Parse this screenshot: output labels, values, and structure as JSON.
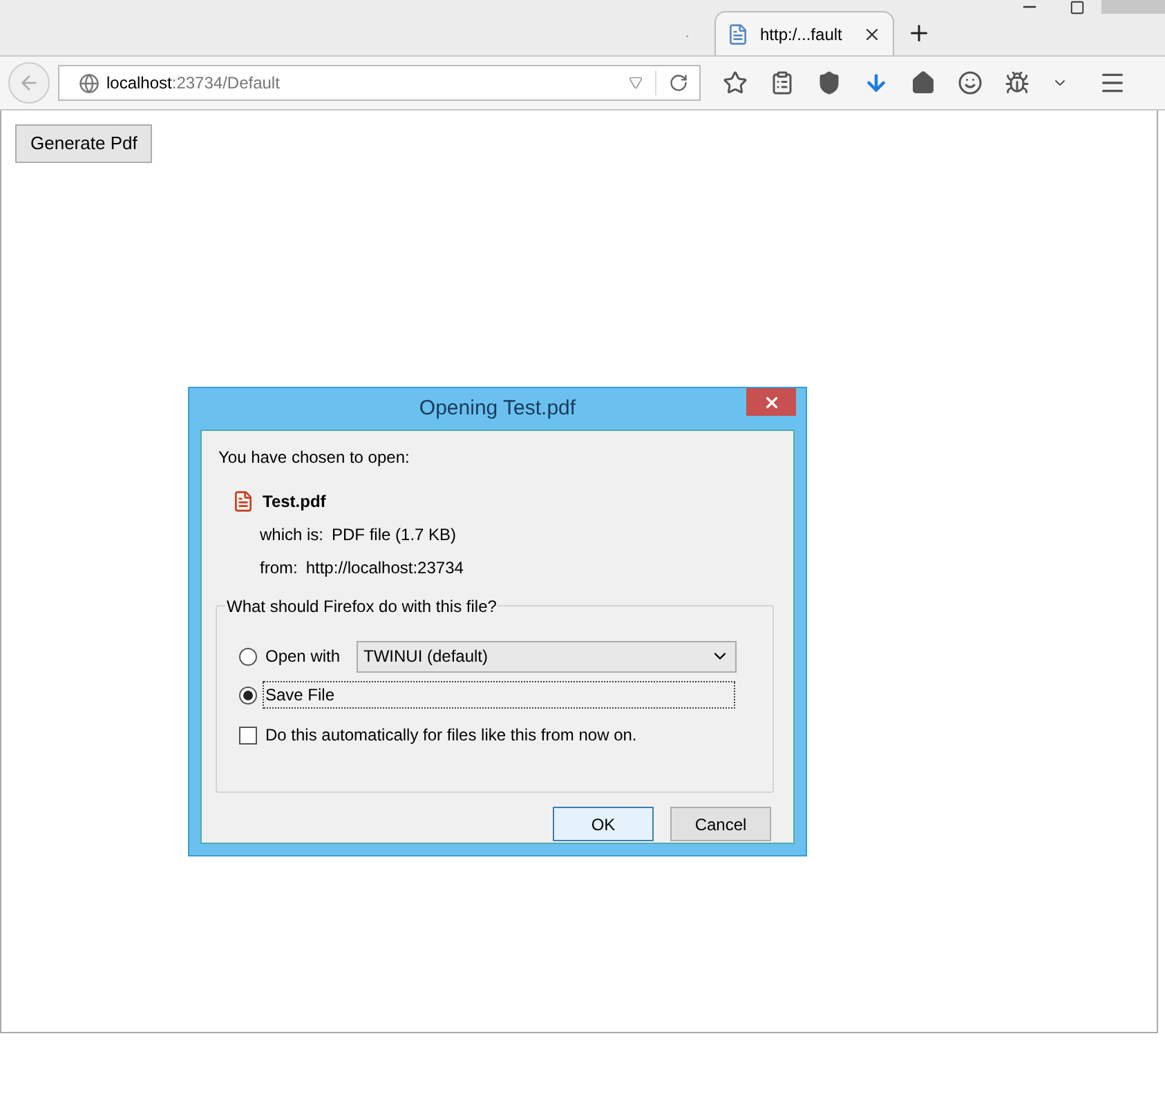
{
  "tabs": [
    {
      "label": ".",
      "selected": false
    },
    {
      "label": "http:/...fault",
      "selected": true
    }
  ],
  "address_bar": {
    "host": "localhost",
    "path": ":23734/Default"
  },
  "page": {
    "button": "Generate Pdf"
  },
  "dialog": {
    "title": "Opening Test.pdf",
    "intro": "You have chosen to open:",
    "file_name": "Test.pdf",
    "details": [
      {
        "label": "which is:",
        "value": "PDF file (1.7 KB)"
      },
      {
        "label": "from:",
        "value": "http://localhost:23734"
      }
    ],
    "group_label": "What should Firefox do with this file?",
    "options": [
      {
        "kind": "open_with",
        "label": "Open with",
        "selected": false,
        "app": "TWINUI (default)"
      },
      {
        "kind": "save",
        "label": "Save File",
        "selected": true
      }
    ],
    "auto_checkbox": {
      "label": "Do this automatically for files like this from now on.",
      "checked": false
    },
    "buttons": [
      {
        "label": "OK",
        "default": true
      },
      {
        "label": "Cancel",
        "default": false
      }
    ]
  }
}
